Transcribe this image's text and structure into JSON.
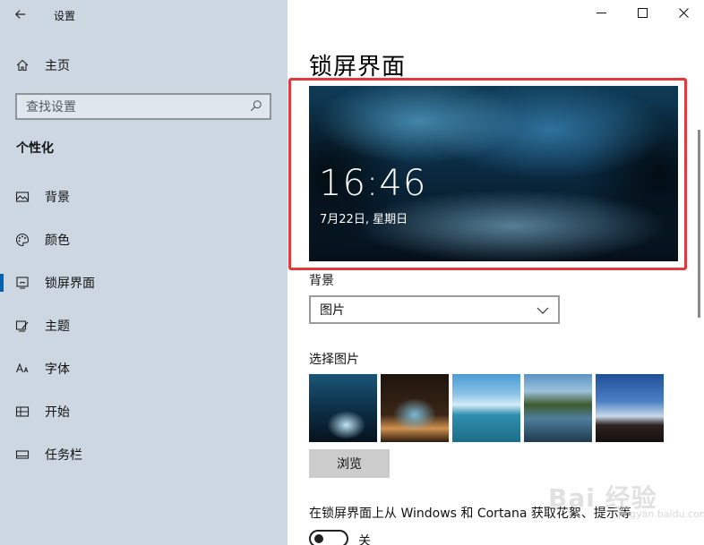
{
  "window": {
    "app_title": "设置",
    "back_icon": "back-arrow-icon",
    "controls": [
      "minimize-icon",
      "maximize-icon",
      "close-icon"
    ]
  },
  "sidebar": {
    "home_label": "主页",
    "search_placeholder": "查找设置",
    "section_title": "个性化",
    "items": [
      {
        "label": "背景",
        "icon": "picture-icon",
        "active": false
      },
      {
        "label": "颜色",
        "icon": "palette-icon",
        "active": false
      },
      {
        "label": "锁屏界面",
        "icon": "lock-screen-icon",
        "active": true
      },
      {
        "label": "主题",
        "icon": "theme-icon",
        "active": false
      },
      {
        "label": "字体",
        "icon": "font-icon",
        "active": false
      },
      {
        "label": "开始",
        "icon": "start-icon",
        "active": false
      },
      {
        "label": "任务栏",
        "icon": "taskbar-icon",
        "active": false
      }
    ]
  },
  "main": {
    "page_title": "锁屏界面",
    "preview": {
      "time": "16:46",
      "date": "7月22日, 星期日"
    },
    "background_label": "背景",
    "background_value": "图片",
    "choose_picture_label": "选择图片",
    "browse_label": "浏览",
    "spotlight_text": "在锁屏界面上从 Windows 和 Cortana 获取花絮、提示等",
    "toggle_label": "关",
    "toggle_on": false
  },
  "watermark": {
    "text": "Bai 经验",
    "sub": "jingyan.baidu.com"
  },
  "colors": {
    "sidebar_bg": "#ccd7e1",
    "accent": "#0063b1",
    "highlight_frame": "#e0393e"
  }
}
